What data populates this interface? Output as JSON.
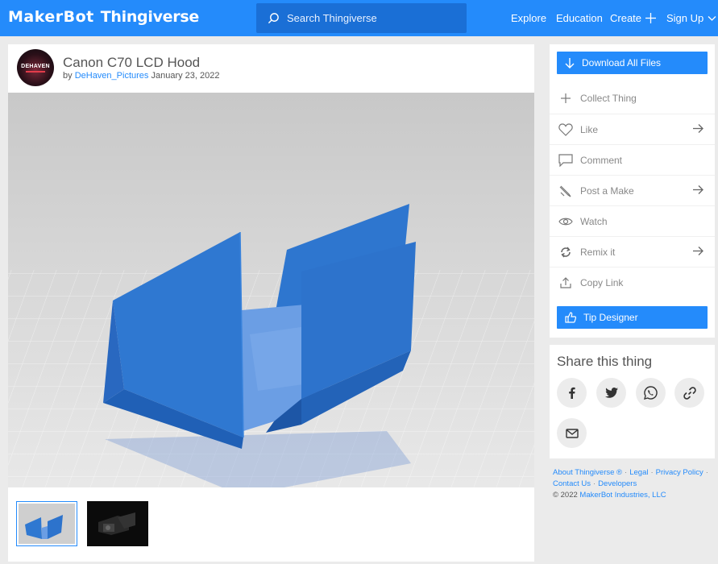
{
  "header": {
    "logo_maker": "MakerBot",
    "logo_thing": "Thingiverse",
    "search_placeholder": "Search Thingiverse",
    "nav": [
      "Explore",
      "Education",
      "Create",
      "Sign Up"
    ]
  },
  "thing": {
    "title": "Canon C70 LCD Hood",
    "by": "by",
    "author": "DeHaven_Pictures",
    "date": "January 23, 2022",
    "avatar_text": "DEHAVEN"
  },
  "actions": {
    "download": "Download All Files",
    "collect": "Collect Thing",
    "like": "Like",
    "comment": "Comment",
    "post_make": "Post a Make",
    "watch": "Watch",
    "remix": "Remix it",
    "copy_link": "Copy Link",
    "tip": "Tip Designer"
  },
  "share": {
    "title": "Share this thing",
    "icons": [
      "facebook-icon",
      "twitter-icon",
      "whatsapp-icon",
      "link-icon",
      "email-icon"
    ]
  },
  "footer": {
    "about": "About Thingiverse ®",
    "legal": "Legal",
    "privacy": "Privacy Policy",
    "contact": "Contact Us",
    "developers": "Developers",
    "copyright": "©  2022 MakerBot Industries, LLC"
  },
  "colors": {
    "brand": "#248bfb",
    "model_blue": "#2f78d1",
    "page_bg": "#ebebeb"
  }
}
